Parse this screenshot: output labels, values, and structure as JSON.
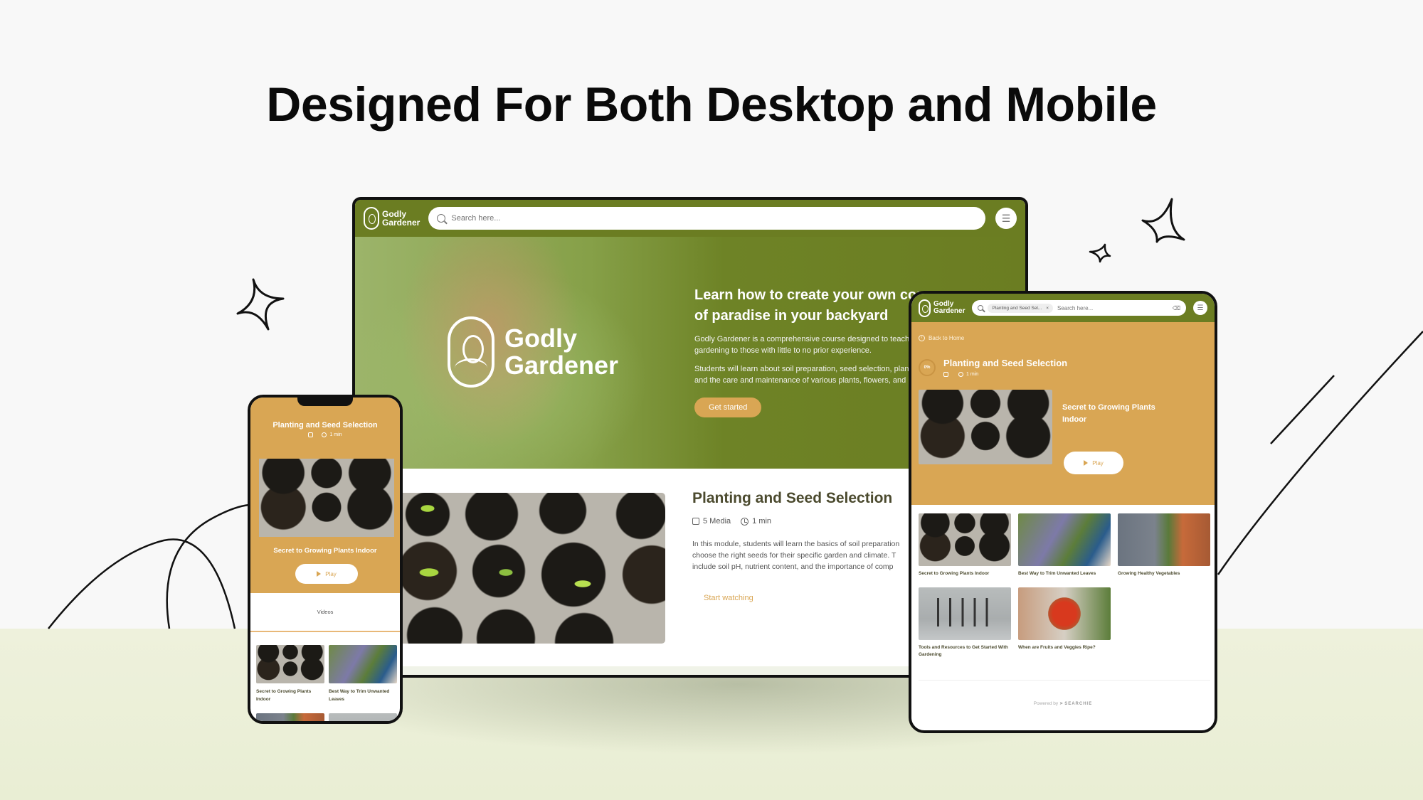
{
  "headline": "Designed For Both Desktop and Mobile",
  "brand": {
    "line1": "Godly",
    "line2": "Gardener"
  },
  "colors": {
    "primary_green": "#6b7d22",
    "accent_gold": "#d9a654",
    "title_olive": "#4b4a2e"
  },
  "desktop": {
    "search": {
      "placeholder": "Search here..."
    },
    "menu_icon": "hamburger-icon",
    "hero": {
      "title_line1": "Learn how to create your own corner",
      "title_line2": "of paradise in your backyard",
      "para1_line1": "Godly Gardener is a comprehensive course designed to teach",
      "para1_line2": "gardening to those with little to no prior experience.",
      "para2_line1": "Students will learn about soil preparation, seed selection, planting,",
      "para2_line2": "and the care and maintenance of various plants, flowers, and",
      "cta": "Get started"
    },
    "module": {
      "title": "Planting and Seed Selection",
      "media_count": "5 Media",
      "duration": "1 min",
      "desc_line1": "In this module, students will learn the basics of soil preparation",
      "desc_line2": "choose the right seeds for their specific garden and climate. T",
      "desc_line3": "include soil pH, nutrient content, and the importance of comp",
      "cta": "Start watching"
    }
  },
  "tablet": {
    "search_chip": "Planting and Seed Sel...",
    "chip_close": "×",
    "search": {
      "placeholder": "Search here..."
    },
    "back_link": "Back to Home",
    "progress": "0%",
    "module_title": "Planting and Seed Selection",
    "duration": "1 min",
    "featured_video": {
      "title": "Secret to Growing Plants Indoor",
      "play": "Play"
    },
    "videos": [
      {
        "title": "Secret to Growing Plants Indoor"
      },
      {
        "title": "Best Way to Trim Unwanted Leaves"
      },
      {
        "title": "Growing Healthy Vegetables"
      },
      {
        "title": "Tools and Resources to Get Started With Gardening"
      },
      {
        "title": "When are Fruits and Veggies Ripe?"
      }
    ],
    "powered_by": "Powered by",
    "powered_brand": "SEARCHIE"
  },
  "phone": {
    "module_title": "Planting and Seed Selection",
    "duration": "1 min",
    "featured_video": {
      "title": "Secret to Growing Plants Indoor",
      "play": "Play"
    },
    "tab": "Videos",
    "videos": [
      {
        "title": "Secret to Growing Plants Indoor"
      },
      {
        "title": "Best Way to Trim Unwanted Leaves"
      },
      {
        "title": ""
      },
      {
        "title": ""
      }
    ]
  }
}
